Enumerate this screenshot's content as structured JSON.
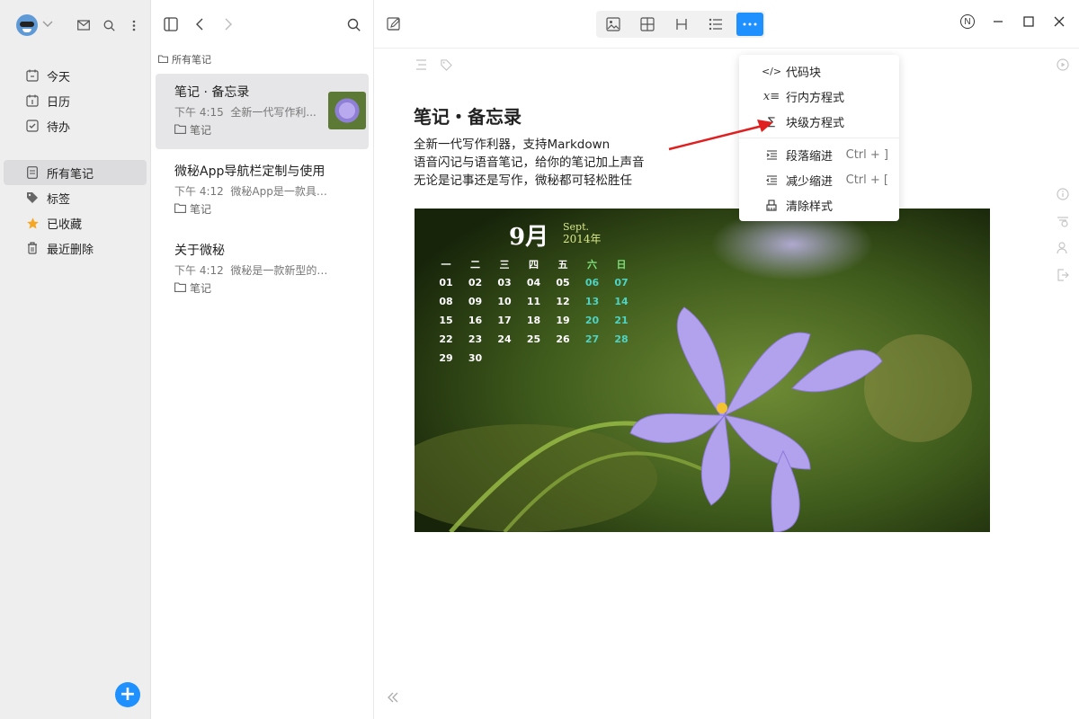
{
  "sidebar": {
    "items": [
      {
        "label": "今天",
        "icon": "today-calendar-icon"
      },
      {
        "label": "日历",
        "icon": "calendar-icon"
      },
      {
        "label": "待办",
        "icon": "checkbox-icon"
      },
      {
        "label": "所有笔记",
        "icon": "notes-icon"
      },
      {
        "label": "标签",
        "icon": "tag-icon"
      },
      {
        "label": "已收藏",
        "icon": "star-icon"
      },
      {
        "label": "最近删除",
        "icon": "trash-icon"
      }
    ],
    "active_index": 3,
    "star_color": "#f5a623"
  },
  "list": {
    "breadcrumb": "所有笔记",
    "notes": [
      {
        "title": "笔记 · 备忘录",
        "time": "下午 4:15",
        "preview": "全新一代写作利...",
        "folder": "笔记",
        "has_thumb": true
      },
      {
        "title": "微秘App导航栏定制与使用",
        "time": "下午 4:12",
        "preview": "微秘App是一款具有高...",
        "folder": "笔记",
        "has_thumb": false
      },
      {
        "title": "关于微秘",
        "time": "下午 4:12",
        "preview": "微秘是一款新型的个人...",
        "folder": "笔记",
        "has_thumb": false
      }
    ]
  },
  "editor": {
    "title": "笔记・备忘录",
    "lines": [
      "全新一代写作利器，支持Markdown",
      "语音闪记与语音笔记，给你的笔记加上声音",
      "无论是记事还是写作，微秘都可轻松胜任"
    ]
  },
  "calendar_image": {
    "month": "9月",
    "month_en": "Sept.",
    "year": "2014年",
    "weekdays": [
      "一",
      "二",
      "三",
      "四",
      "五",
      "六",
      "日"
    ],
    "rows": [
      [
        "01",
        "02",
        "03",
        "04",
        "05",
        "06",
        "07"
      ],
      [
        "08",
        "09",
        "10",
        "11",
        "12",
        "13",
        "14"
      ],
      [
        "15",
        "16",
        "17",
        "18",
        "19",
        "20",
        "21"
      ],
      [
        "22",
        "23",
        "24",
        "25",
        "26",
        "27",
        "28"
      ],
      [
        "29",
        "30",
        "",
        "",
        "",
        "",
        ""
      ]
    ]
  },
  "menu": {
    "items": [
      {
        "label": "代码块",
        "icon": "code-icon",
        "shortcut": ""
      },
      {
        "label": "行内方程式",
        "icon": "inline-formula-icon",
        "shortcut": ""
      },
      {
        "label": "块级方程式",
        "icon": "block-formula-icon",
        "shortcut": ""
      },
      {
        "label": "段落缩进",
        "icon": "indent-icon",
        "shortcut": "Ctrl + ]"
      },
      {
        "label": "减少缩进",
        "icon": "outdent-icon",
        "shortcut": "Ctrl + ["
      },
      {
        "label": "清除样式",
        "icon": "clear-format-icon",
        "shortcut": ""
      }
    ]
  },
  "colors": {
    "accent": "#1e90ff",
    "arrow": "#e02020"
  },
  "window": {
    "n_badge": "N"
  }
}
